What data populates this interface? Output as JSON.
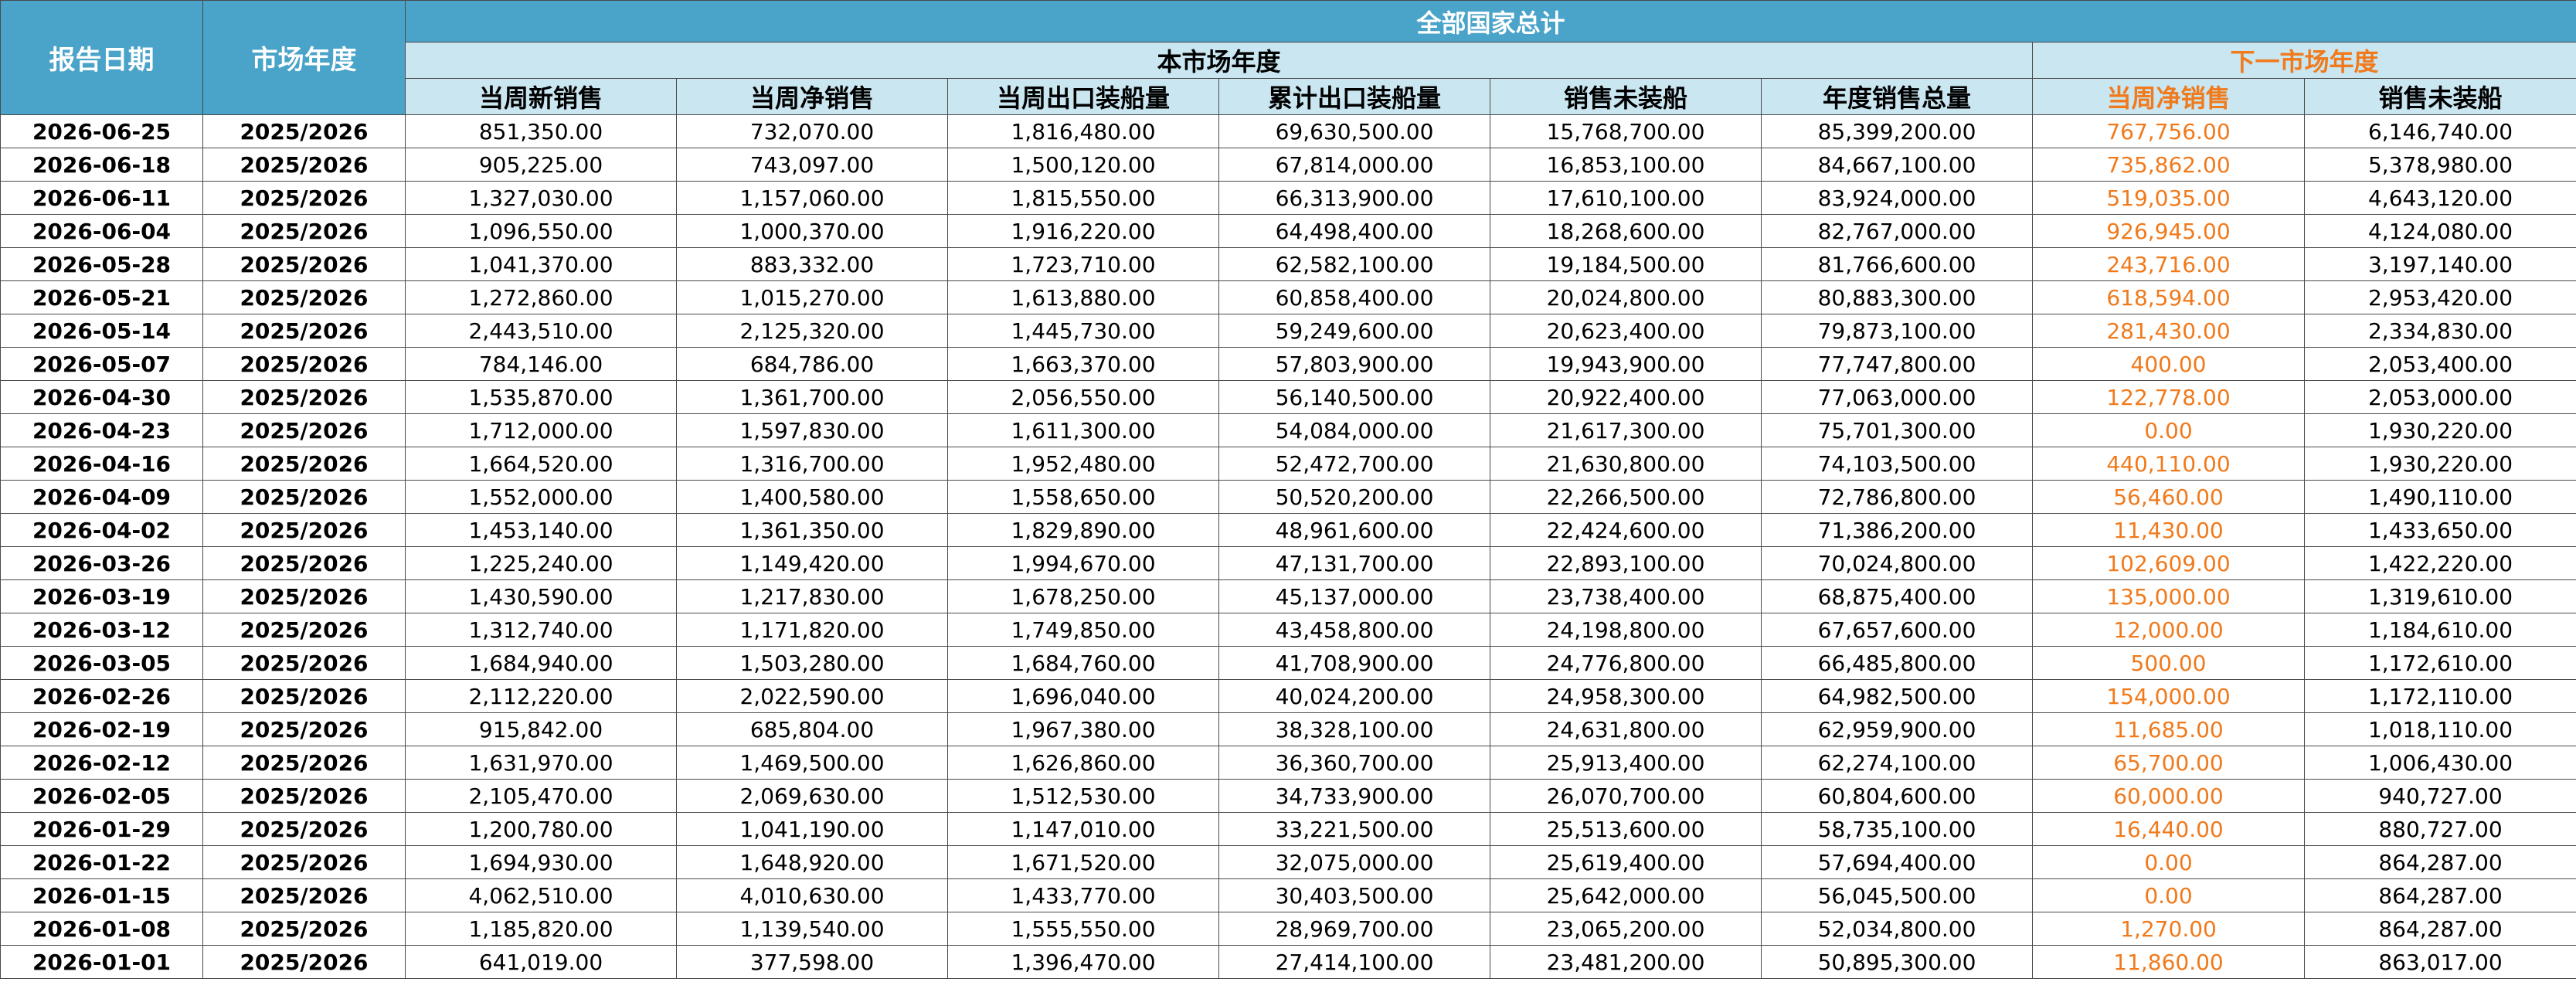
{
  "header": {
    "report_date": "报告日期",
    "market_year": "市场年度",
    "all_countries": "全部国家总计",
    "current_year": "本市场年度",
    "next_year": "下一市场年度",
    "columns": [
      "当周新销售",
      "当周净销售",
      "当周出口装船量",
      "累计出口装船量",
      "销售未装船",
      "年度销售总量"
    ],
    "next_columns": [
      "当周净销售",
      "销售未装船"
    ]
  },
  "colors": {
    "header_blue": "#4aa3c8",
    "header_light": "#c9e6f1",
    "accent_orange": "#f07a1c"
  },
  "rows": [
    [
      "2026-06-25",
      "2025/2026",
      "851,350.00",
      "732,070.00",
      "1,816,480.00",
      "69,630,500.00",
      "15,768,700.00",
      "85,399,200.00",
      "767,756.00",
      "6,146,740.00"
    ],
    [
      "2026-06-18",
      "2025/2026",
      "905,225.00",
      "743,097.00",
      "1,500,120.00",
      "67,814,000.00",
      "16,853,100.00",
      "84,667,100.00",
      "735,862.00",
      "5,378,980.00"
    ],
    [
      "2026-06-11",
      "2025/2026",
      "1,327,030.00",
      "1,157,060.00",
      "1,815,550.00",
      "66,313,900.00",
      "17,610,100.00",
      "83,924,000.00",
      "519,035.00",
      "4,643,120.00"
    ],
    [
      "2026-06-04",
      "2025/2026",
      "1,096,550.00",
      "1,000,370.00",
      "1,916,220.00",
      "64,498,400.00",
      "18,268,600.00",
      "82,767,000.00",
      "926,945.00",
      "4,124,080.00"
    ],
    [
      "2026-05-28",
      "2025/2026",
      "1,041,370.00",
      "883,332.00",
      "1,723,710.00",
      "62,582,100.00",
      "19,184,500.00",
      "81,766,600.00",
      "243,716.00",
      "3,197,140.00"
    ],
    [
      "2026-05-21",
      "2025/2026",
      "1,272,860.00",
      "1,015,270.00",
      "1,613,880.00",
      "60,858,400.00",
      "20,024,800.00",
      "80,883,300.00",
      "618,594.00",
      "2,953,420.00"
    ],
    [
      "2026-05-14",
      "2025/2026",
      "2,443,510.00",
      "2,125,320.00",
      "1,445,730.00",
      "59,249,600.00",
      "20,623,400.00",
      "79,873,100.00",
      "281,430.00",
      "2,334,830.00"
    ],
    [
      "2026-05-07",
      "2025/2026",
      "784,146.00",
      "684,786.00",
      "1,663,370.00",
      "57,803,900.00",
      "19,943,900.00",
      "77,747,800.00",
      "400.00",
      "2,053,400.00"
    ],
    [
      "2026-04-30",
      "2025/2026",
      "1,535,870.00",
      "1,361,700.00",
      "2,056,550.00",
      "56,140,500.00",
      "20,922,400.00",
      "77,063,000.00",
      "122,778.00",
      "2,053,000.00"
    ],
    [
      "2026-04-23",
      "2025/2026",
      "1,712,000.00",
      "1,597,830.00",
      "1,611,300.00",
      "54,084,000.00",
      "21,617,300.00",
      "75,701,300.00",
      "0.00",
      "1,930,220.00"
    ],
    [
      "2026-04-16",
      "2025/2026",
      "1,664,520.00",
      "1,316,700.00",
      "1,952,480.00",
      "52,472,700.00",
      "21,630,800.00",
      "74,103,500.00",
      "440,110.00",
      "1,930,220.00"
    ],
    [
      "2026-04-09",
      "2025/2026",
      "1,552,000.00",
      "1,400,580.00",
      "1,558,650.00",
      "50,520,200.00",
      "22,266,500.00",
      "72,786,800.00",
      "56,460.00",
      "1,490,110.00"
    ],
    [
      "2026-04-02",
      "2025/2026",
      "1,453,140.00",
      "1,361,350.00",
      "1,829,890.00",
      "48,961,600.00",
      "22,424,600.00",
      "71,386,200.00",
      "11,430.00",
      "1,433,650.00"
    ],
    [
      "2026-03-26",
      "2025/2026",
      "1,225,240.00",
      "1,149,420.00",
      "1,994,670.00",
      "47,131,700.00",
      "22,893,100.00",
      "70,024,800.00",
      "102,609.00",
      "1,422,220.00"
    ],
    [
      "2026-03-19",
      "2025/2026",
      "1,430,590.00",
      "1,217,830.00",
      "1,678,250.00",
      "45,137,000.00",
      "23,738,400.00",
      "68,875,400.00",
      "135,000.00",
      "1,319,610.00"
    ],
    [
      "2026-03-12",
      "2025/2026",
      "1,312,740.00",
      "1,171,820.00",
      "1,749,850.00",
      "43,458,800.00",
      "24,198,800.00",
      "67,657,600.00",
      "12,000.00",
      "1,184,610.00"
    ],
    [
      "2026-03-05",
      "2025/2026",
      "1,684,940.00",
      "1,503,280.00",
      "1,684,760.00",
      "41,708,900.00",
      "24,776,800.00",
      "66,485,800.00",
      "500.00",
      "1,172,610.00"
    ],
    [
      "2026-02-26",
      "2025/2026",
      "2,112,220.00",
      "2,022,590.00",
      "1,696,040.00",
      "40,024,200.00",
      "24,958,300.00",
      "64,982,500.00",
      "154,000.00",
      "1,172,110.00"
    ],
    [
      "2026-02-19",
      "2025/2026",
      "915,842.00",
      "685,804.00",
      "1,967,380.00",
      "38,328,100.00",
      "24,631,800.00",
      "62,959,900.00",
      "11,685.00",
      "1,018,110.00"
    ],
    [
      "2026-02-12",
      "2025/2026",
      "1,631,970.00",
      "1,469,500.00",
      "1,626,860.00",
      "36,360,700.00",
      "25,913,400.00",
      "62,274,100.00",
      "65,700.00",
      "1,006,430.00"
    ],
    [
      "2026-02-05",
      "2025/2026",
      "2,105,470.00",
      "2,069,630.00",
      "1,512,530.00",
      "34,733,900.00",
      "26,070,700.00",
      "60,804,600.00",
      "60,000.00",
      "940,727.00"
    ],
    [
      "2026-01-29",
      "2025/2026",
      "1,200,780.00",
      "1,041,190.00",
      "1,147,010.00",
      "33,221,500.00",
      "25,513,600.00",
      "58,735,100.00",
      "16,440.00",
      "880,727.00"
    ],
    [
      "2026-01-22",
      "2025/2026",
      "1,694,930.00",
      "1,648,920.00",
      "1,671,520.00",
      "32,075,000.00",
      "25,619,400.00",
      "57,694,400.00",
      "0.00",
      "864,287.00"
    ],
    [
      "2026-01-15",
      "2025/2026",
      "4,062,510.00",
      "4,010,630.00",
      "1,433,770.00",
      "30,403,500.00",
      "25,642,000.00",
      "56,045,500.00",
      "0.00",
      "864,287.00"
    ],
    [
      "2026-01-08",
      "2025/2026",
      "1,185,820.00",
      "1,139,540.00",
      "1,555,550.00",
      "28,969,700.00",
      "23,065,200.00",
      "52,034,800.00",
      "1,270.00",
      "864,287.00"
    ],
    [
      "2026-01-01",
      "2025/2026",
      "641,019.00",
      "377,598.00",
      "1,396,470.00",
      "27,414,100.00",
      "23,481,200.00",
      "50,895,300.00",
      "11,860.00",
      "863,017.00"
    ]
  ]
}
